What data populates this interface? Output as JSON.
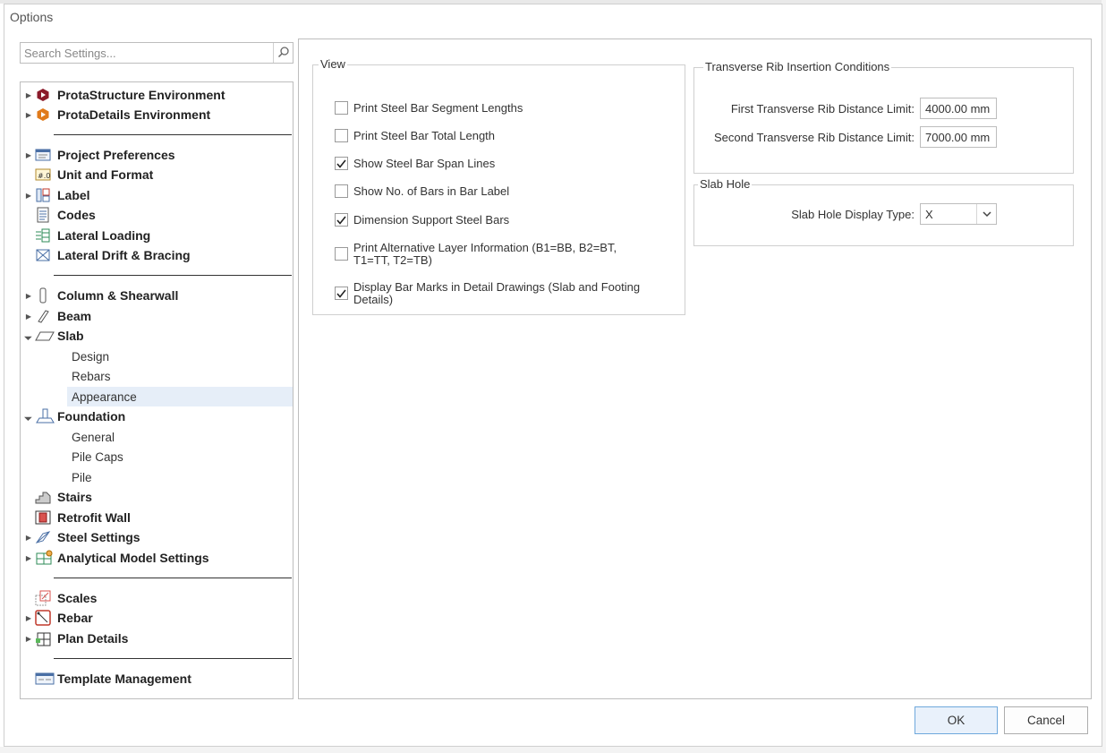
{
  "window": {
    "title": "Options"
  },
  "search": {
    "placeholder": "Search Settings..."
  },
  "tree": [
    {
      "label": "ProtaStructure Environment",
      "icon": "protastructure-icon",
      "arrow": "collapsed"
    },
    {
      "label": "ProtaDetails Environment",
      "icon": "protadetails-icon",
      "arrow": "collapsed"
    },
    {
      "label": "Project Preferences",
      "icon": "project-preferences-icon",
      "arrow": "collapsed"
    },
    {
      "label": "Unit and Format",
      "icon": "unit-format-icon",
      "arrow": "none"
    },
    {
      "label": "Label",
      "icon": "label-icon",
      "arrow": "collapsed"
    },
    {
      "label": "Codes",
      "icon": "codes-icon",
      "arrow": "none"
    },
    {
      "label": "Lateral Loading",
      "icon": "lateral-loading-icon",
      "arrow": "none"
    },
    {
      "label": "Lateral Drift & Bracing",
      "icon": "lateral-drift-icon",
      "arrow": "none"
    },
    {
      "label": "Column & Shearwall",
      "icon": "column-icon",
      "arrow": "collapsed"
    },
    {
      "label": "Beam",
      "icon": "beam-icon",
      "arrow": "collapsed"
    },
    {
      "label": "Slab",
      "icon": "slab-icon",
      "arrow": "expanded"
    },
    {
      "label": "Design",
      "child": true
    },
    {
      "label": "Rebars",
      "child": true
    },
    {
      "label": "Appearance",
      "child": true,
      "selected": true
    },
    {
      "label": "Foundation",
      "icon": "foundation-icon",
      "arrow": "expanded"
    },
    {
      "label": "General",
      "child": true
    },
    {
      "label": "Pile Caps",
      "child": true
    },
    {
      "label": "Pile",
      "child": true
    },
    {
      "label": "Stairs",
      "icon": "stairs-icon",
      "arrow": "none"
    },
    {
      "label": "Retrofit Wall",
      "icon": "retrofit-wall-icon",
      "arrow": "none"
    },
    {
      "label": "Steel Settings",
      "icon": "steel-settings-icon",
      "arrow": "collapsed"
    },
    {
      "label": "Analytical Model Settings",
      "icon": "analytical-model-icon",
      "arrow": "collapsed"
    },
    {
      "label": "Scales",
      "icon": "scales-icon",
      "arrow": "none"
    },
    {
      "label": "Rebar",
      "icon": "rebar-icon",
      "arrow": "collapsed"
    },
    {
      "label": "Plan Details",
      "icon": "plan-details-icon",
      "arrow": "collapsed"
    },
    {
      "label": "Template Management",
      "icon": "template-management-icon",
      "arrow": "none"
    }
  ],
  "view_group": {
    "title": "View",
    "options": [
      {
        "label": "Print Steel Bar Segment Lengths",
        "checked": false
      },
      {
        "label": "Print Steel Bar Total Length",
        "checked": false
      },
      {
        "label": "Show Steel Bar Span Lines",
        "checked": true
      },
      {
        "label": "Show No. of Bars in Bar Label",
        "checked": false
      },
      {
        "label": "Dimension Support Steel Bars",
        "checked": true
      },
      {
        "label": "Print Alternative Layer Information (B1=BB, B2=BT, T1=TT, T2=TB)",
        "checked": false
      },
      {
        "label": "Display Bar Marks in Detail Drawings (Slab and Footing Details)",
        "checked": true
      }
    ]
  },
  "rib_group": {
    "title": "Transverse Rib Insertion Conditions",
    "first_label": "First Transverse Rib Distance Limit:",
    "first_value": "4000.00 mm",
    "second_label": "Second Transverse Rib Distance Limit:",
    "second_value": "7000.00 mm"
  },
  "slab_hole_group": {
    "title": "Slab Hole",
    "type_label": "Slab Hole Display Type:",
    "type_value": "X"
  },
  "buttons": {
    "ok": "OK",
    "cancel": "Cancel"
  }
}
